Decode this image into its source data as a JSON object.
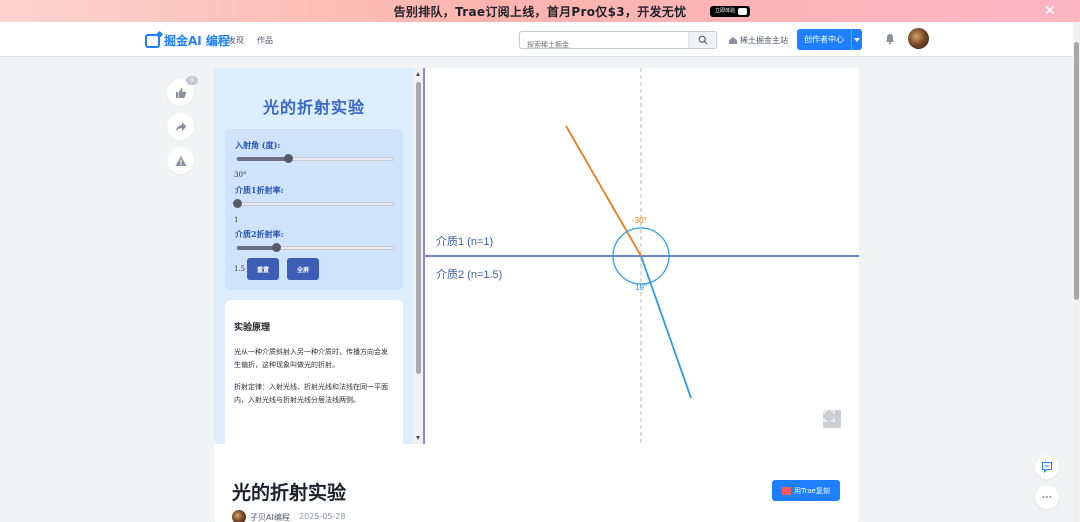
{
  "banner": {
    "text": "告别排队，Trae订阅上线，首月Pro仅$3，开发无忧",
    "cta": "立即体验"
  },
  "header": {
    "logo_text": "掘金AI 编程",
    "nav": [
      "发现",
      "作品"
    ],
    "search_placeholder": "探索稀土掘金",
    "site_link": "稀土掘金主站",
    "creator_button": "创作者中心"
  },
  "actions": {
    "like_count": "0"
  },
  "experiment": {
    "title": "光的折射实验",
    "controls": {
      "angle_label": "入射角 (度):",
      "angle_value": "30°",
      "angle_fraction": 0.33,
      "n1_label": "介质1折射率:",
      "n1_value": "1",
      "n1_fraction": 0.0,
      "n2_label": "介质2折射率:",
      "n2_value": "1.5",
      "n2_fraction": 0.25,
      "reset_button": "重置",
      "fullscreen_button": "全屏"
    },
    "theory": {
      "heading": "实验原理",
      "paragraphs": [
        "光从一种介质斜射入另一种介质时，传播方向会发生偏折，这种现象叫做光的折射。",
        "折射定律：入射光线、折射光线和法线在同一平面内，入射光线与折射光线分居法线两侧。"
      ]
    },
    "scene": {
      "medium1_label": "介质1 (n=1)",
      "medium2_label": "介质2 (n=1.5)",
      "incident_angle_label": "-30°",
      "refracted_angle_label": "19°",
      "incident_color": "#f07a1c",
      "refracted_color": "#2a9be8",
      "interface_color": "#3a5fa8"
    }
  },
  "article": {
    "title": "光的折射实验",
    "trae_button": "用Trae复刻",
    "author": "子贝AI编程",
    "date": "2025-05-28"
  },
  "colors": {
    "brand": "#1e80ff",
    "panel_bg": "#ddeefe",
    "button": "#3d5db7"
  }
}
